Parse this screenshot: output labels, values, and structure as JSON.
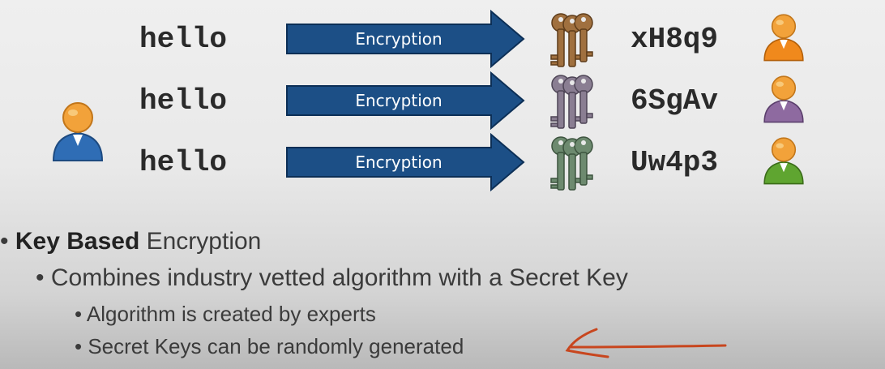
{
  "rows": [
    {
      "plaintext": "hello",
      "arrow_label": "Encryption",
      "ciphertext": "xH8q9",
      "key_color": "#a0703f",
      "person_color": "#f0891c"
    },
    {
      "plaintext": "hello",
      "arrow_label": "Encryption",
      "ciphertext": "6SgAv",
      "key_color": "#8a7e92",
      "person_color": "#8e6aa0"
    },
    {
      "plaintext": "hello",
      "arrow_label": "Encryption",
      "ciphertext": "Uw4p3",
      "key_color": "#6d8a6f",
      "person_color": "#5fa530"
    }
  ],
  "sender": {
    "icon": "user-icon",
    "color": "#2f6db5"
  },
  "bullets": {
    "l1_bold": "Key Based",
    "l1_rest": " Encryption",
    "l2": "Combines industry vetted algorithm with a Secret Key",
    "l3": "Algorithm is created by experts",
    "l4": "Secret Keys can be randomly generated"
  },
  "annotation": {
    "icon": "hand-drawn-arrow-icon",
    "color": "#c8461e"
  },
  "colors": {
    "arrow_fill": "#1c4f86",
    "arrow_stroke": "#0c2f56"
  }
}
